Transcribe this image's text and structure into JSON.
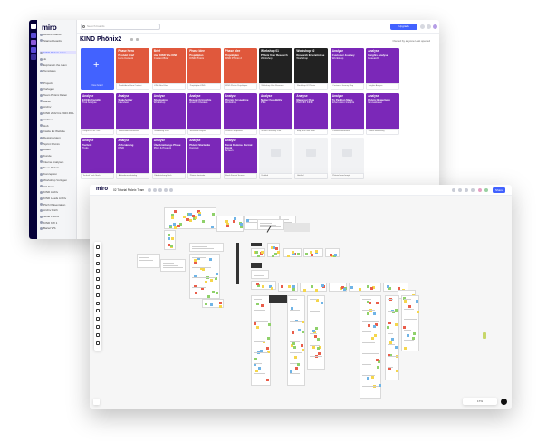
{
  "colors": {
    "purple": "#7b28b8",
    "red": "#e0583c",
    "black": "#222222",
    "brand_blue": "#4262ff",
    "sticky_yellow": "#f5d64c",
    "sticky_green": "#8fd16a",
    "sticky_red": "#e95d4a",
    "sticky_blue": "#6fb4e6"
  },
  "dashboard": {
    "logo": "miro",
    "board_title": "KIND Phönix2",
    "search_placeholder": "Search boards",
    "upgrade_label": "Upgrade",
    "filters_label": "Owned by anyone    Last opened",
    "sidebar_items": [
      "Recent boards",
      "Starred boards",
      "",
      "KIND Phönix team",
      "Jo",
      "Explore in the team",
      "Templates",
      "",
      "Projects",
      "Vorlagen",
      "Team Phönix Daten",
      "Bartel",
      "Archiv",
      "KIND 2022 bis 2023 ZIEL",
      "Archiv 2",
      "Hub",
      "Inside Ex Website",
      "Designsystem",
      "Sprint Phönix",
      "Daten",
      "Kunde",
      "Interne Analysen",
      "Neue Phönix",
      "Konzeption",
      "Workshop Vorlagen",
      "UX Tests",
      "KIND Archiv",
      "KIND Leads Archiv",
      "Pitch Präsentation",
      "Archiv Pitch",
      "Neue Phönix",
      "KIND KW 1",
      "Bartel WS"
    ],
    "add_card_label": "New board",
    "cards": [
      {
        "color": "red",
        "kicker": "Phase Hero",
        "title": "Produkt Brief",
        "sub": "Hero Content",
        "footer": "Produktbrief Hero Content"
      },
      {
        "color": "red",
        "kicker": "Brief",
        "title": "Hier KIND Wie KIND",
        "sub": "Content Brief",
        "footer": "KIND Brief Hero"
      },
      {
        "color": "red",
        "kicker": "Phase Idee",
        "title": "Projektplan",
        "sub": "KIND Phönix",
        "footer": "Projektplan KIND"
      },
      {
        "color": "red",
        "kicker": "Phase Idee",
        "title": "Projektplan",
        "sub": "KIND Phönix 2",
        "footer": "KIND Phönix Projektplan"
      },
      {
        "color": "black",
        "kicker": "Workshop 01",
        "title": "Phönix User Research",
        "sub": "Workshop",
        "footer": "Workshop User Research"
      },
      {
        "color": "black",
        "kicker": "Workshop 02",
        "title": "Research Erkenntnisse",
        "sub": "Workshop",
        "footer": "Workshop 02 Phönix"
      },
      {
        "color": "purple",
        "kicker": "Analyse",
        "title": "Customer Journey",
        "sub": "Workshop",
        "footer": "Customer Journey Map"
      },
      {
        "color": "purple",
        "kicker": "Analyse",
        "title": "Insights Analyse",
        "sub": "Research",
        "footer": "Insights Analyse"
      },
      {
        "color": "purple",
        "kicker": "Analyse",
        "title": "EXCEL Insights",
        "sub": "Tool Analyse",
        "footer": "Insight EXCEL Tool"
      },
      {
        "color": "purple",
        "kicker": "Analyse",
        "title": "Stakeholder",
        "sub": "Interviews",
        "footer": "Stakeholder Interviews"
      },
      {
        "color": "purple",
        "kicker": "Analyse",
        "title": "Shadowing",
        "sub": "Workshop",
        "footer": "Shadowing KIND"
      },
      {
        "color": "purple",
        "kicker": "Analyse",
        "title": "Research Insights",
        "sub": "Ansicht Clusters",
        "footer": "Research Insights"
      },
      {
        "color": "purple",
        "kicker": "Analyse",
        "title": "Phönix Perspektive",
        "sub": "Workshop",
        "footer": "Phönix Perspektive"
      },
      {
        "color": "purple",
        "kicker": "Analyse",
        "title": "Nutzer Feasibility",
        "sub": "Pilot",
        "footer": "Nutzer Feasibility Pilot"
      },
      {
        "color": "purple",
        "kicker": "Analyse",
        "title": "Map your Flow",
        "sub": "PHÖNIX KIND",
        "footer": "Map your Flow KIND"
      },
      {
        "color": "purple",
        "kicker": "Analyse",
        "title": "To Pavilion Maps",
        "sub": "Information Insights",
        "footer": "Pavilion Information"
      },
      {
        "color": "purple",
        "kicker": "Analyse",
        "title": "Phönix Bewertung",
        "sub": "Innovationen",
        "footer": "Phönix Bewertung"
      },
      {
        "color": "purple",
        "kicker": "Analyse",
        "title": "Technik",
        "sub": "Tools",
        "footer": "Technik Tools Stack"
      },
      {
        "color": "purple",
        "kicker": "Analyse",
        "title": "Anforderung",
        "sub": "KIND",
        "footer": "Anforderungskatalog"
      },
      {
        "color": "purple",
        "kicker": "Analyse",
        "title": "Überbrückungs Phase",
        "sub": "Pitch & Present",
        "footer": "Überbrückung Pitch"
      },
      {
        "color": "purple",
        "kicker": "Analyse",
        "title": "Phönix Startseite",
        "sub": "Konzept",
        "footer": "Phönix Startseite"
      },
      {
        "color": "purple",
        "kicker": "Analyse",
        "title": "Kiosk Kommu. Format Kiosk",
        "sub": "Screen",
        "footer": "Kiosk Format Screen"
      },
      {
        "color": "empty",
        "kicker": "",
        "title": "",
        "sub": "",
        "footer": "Untitled"
      },
      {
        "color": "empty",
        "kicker": "",
        "title": "",
        "sub": "",
        "footer": "Untitled"
      },
      {
        "color": "empty",
        "kicker": "",
        "title": "",
        "sub": "",
        "footer": "Phönix Board empty"
      }
    ]
  },
  "board": {
    "logo": "miro",
    "name": "02 Tutorial Phönix Team",
    "share_label": "Share",
    "zoom_label": "17%"
  }
}
